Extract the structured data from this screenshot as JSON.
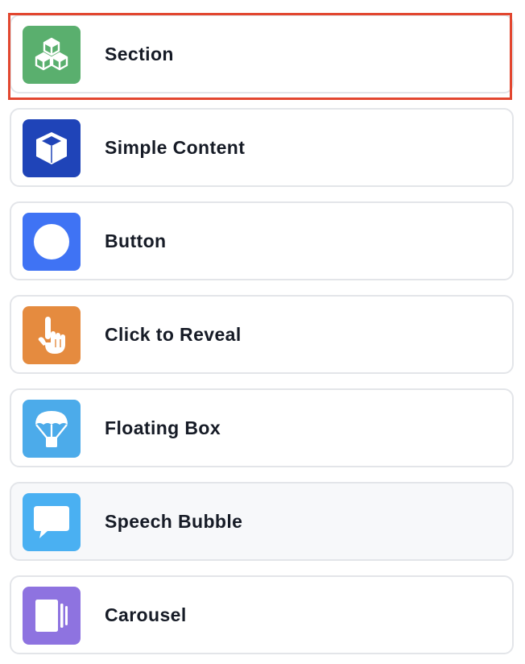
{
  "blocks": [
    {
      "label": "Section",
      "icon": "cubes-icon",
      "color": "#5aaf6e"
    },
    {
      "label": "Simple Content",
      "icon": "box-icon",
      "color": "#1f44b8"
    },
    {
      "label": "Button",
      "icon": "circle-icon",
      "color": "#3f73f4"
    },
    {
      "label": "Click to Reveal",
      "icon": "pointing-hand-icon",
      "color": "#e58b3f"
    },
    {
      "label": "Floating Box",
      "icon": "parachute-icon",
      "color": "#4cabea"
    },
    {
      "label": "Speech Bubble",
      "icon": "speech-bubble-icon",
      "color": "#4ab0f2"
    },
    {
      "label": "Carousel",
      "icon": "carousel-icon",
      "color": "#8e73e0"
    }
  ],
  "selected_index": 0,
  "hovered_index": 5,
  "selection_color": "#e2462f"
}
